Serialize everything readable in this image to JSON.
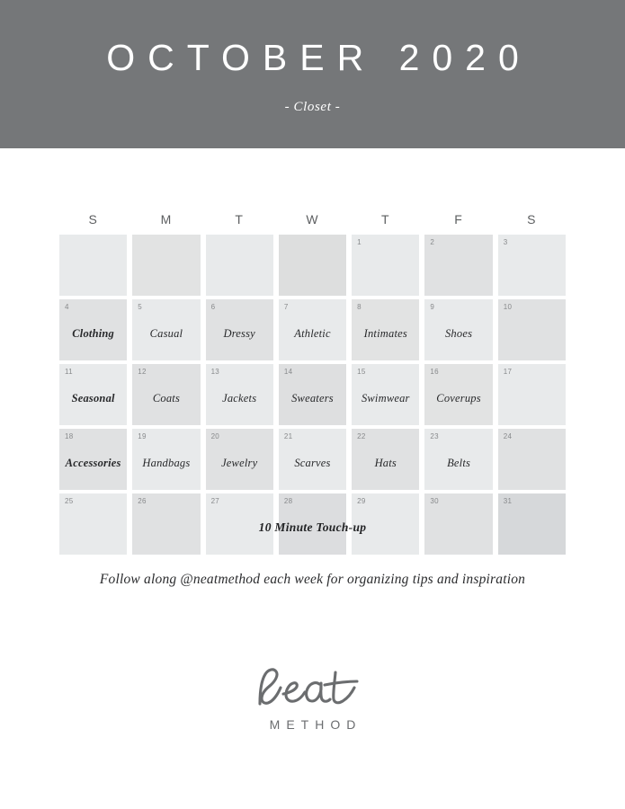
{
  "header": {
    "month_title": "OCTOBER 2020",
    "subtitle": "- Closet -",
    "background_color": "#757779",
    "text_color": "#ffffff"
  },
  "calendar": {
    "weekdays": [
      "S",
      "M",
      "T",
      "W",
      "T",
      "F",
      "S"
    ],
    "weeks": [
      [
        {
          "day": "",
          "label": "",
          "bold": false,
          "shade": "#e8eaeb"
        },
        {
          "day": "",
          "label": "",
          "bold": false,
          "shade": "#e2e3e3"
        },
        {
          "day": "",
          "label": "",
          "bold": false,
          "shade": "#e8eaeb"
        },
        {
          "day": "",
          "label": "",
          "bold": false,
          "shade": "#dddede"
        },
        {
          "day": "1",
          "label": "",
          "bold": false,
          "shade": "#e8eaeb"
        },
        {
          "day": "2",
          "label": "",
          "bold": false,
          "shade": "#e0e1e2"
        },
        {
          "day": "3",
          "label": "",
          "bold": false,
          "shade": "#e8eaeb"
        }
      ],
      [
        {
          "day": "4",
          "label": "Clothing",
          "bold": true,
          "shade": "#e0e1e2"
        },
        {
          "day": "5",
          "label": "Casual",
          "bold": false,
          "shade": "#e8eaeb"
        },
        {
          "day": "6",
          "label": "Dressy",
          "bold": false,
          "shade": "#e0e1e2"
        },
        {
          "day": "7",
          "label": "Athletic",
          "bold": false,
          "shade": "#e8eaeb"
        },
        {
          "day": "8",
          "label": "Intimates",
          "bold": false,
          "shade": "#e2e3e3"
        },
        {
          "day": "9",
          "label": "Shoes",
          "bold": false,
          "shade": "#e8eaeb"
        },
        {
          "day": "10",
          "label": "",
          "bold": false,
          "shade": "#e0e1e2"
        }
      ],
      [
        {
          "day": "11",
          "label": "Seasonal",
          "bold": true,
          "shade": "#e8eaeb"
        },
        {
          "day": "12",
          "label": "Coats",
          "bold": false,
          "shade": "#e0e1e2"
        },
        {
          "day": "13",
          "label": "Jackets",
          "bold": false,
          "shade": "#e8eaeb"
        },
        {
          "day": "14",
          "label": "Sweaters",
          "bold": false,
          "shade": "#dedfe0"
        },
        {
          "day": "15",
          "label": "Swimwear",
          "bold": false,
          "shade": "#e8eaeb"
        },
        {
          "day": "16",
          "label": "Coverups",
          "bold": false,
          "shade": "#e2e3e3"
        },
        {
          "day": "17",
          "label": "",
          "bold": false,
          "shade": "#e8eaeb"
        }
      ],
      [
        {
          "day": "18",
          "label": "Accessories",
          "bold": true,
          "shade": "#e0e1e2"
        },
        {
          "day": "19",
          "label": "Handbags",
          "bold": false,
          "shade": "#e8eaeb"
        },
        {
          "day": "20",
          "label": "Jewelry",
          "bold": false,
          "shade": "#e0e1e2"
        },
        {
          "day": "21",
          "label": "Scarves",
          "bold": false,
          "shade": "#e8eaeb"
        },
        {
          "day": "22",
          "label": "Hats",
          "bold": false,
          "shade": "#e0e1e2"
        },
        {
          "day": "23",
          "label": "Belts",
          "bold": false,
          "shade": "#e8eaeb"
        },
        {
          "day": "24",
          "label": "",
          "bold": false,
          "shade": "#e0e1e2"
        }
      ],
      [
        {
          "day": "25",
          "label": "",
          "bold": false,
          "shade": "#e8eaeb"
        },
        {
          "day": "26",
          "label": "",
          "bold": false,
          "shade": "#e0e1e2"
        },
        {
          "day": "27",
          "label": "",
          "bold": false,
          "shade": "#e8eaeb"
        },
        {
          "day": "28",
          "label": "",
          "bold": false,
          "shade": "#dcdddf"
        },
        {
          "day": "29",
          "label": "",
          "bold": false,
          "shade": "#e8eaeb"
        },
        {
          "day": "30",
          "label": "",
          "bold": false,
          "shade": "#e0e1e2"
        },
        {
          "day": "31",
          "label": "",
          "bold": false,
          "shade": "#d6d8da"
        }
      ]
    ],
    "last_week_banner": "10 Minute Touch-up"
  },
  "tagline": "Follow along @neatmethod each week for organizing tips and inspiration",
  "logo": {
    "wordmark": "neat",
    "subtext": "METHOD",
    "color": "#6b6d6f"
  }
}
